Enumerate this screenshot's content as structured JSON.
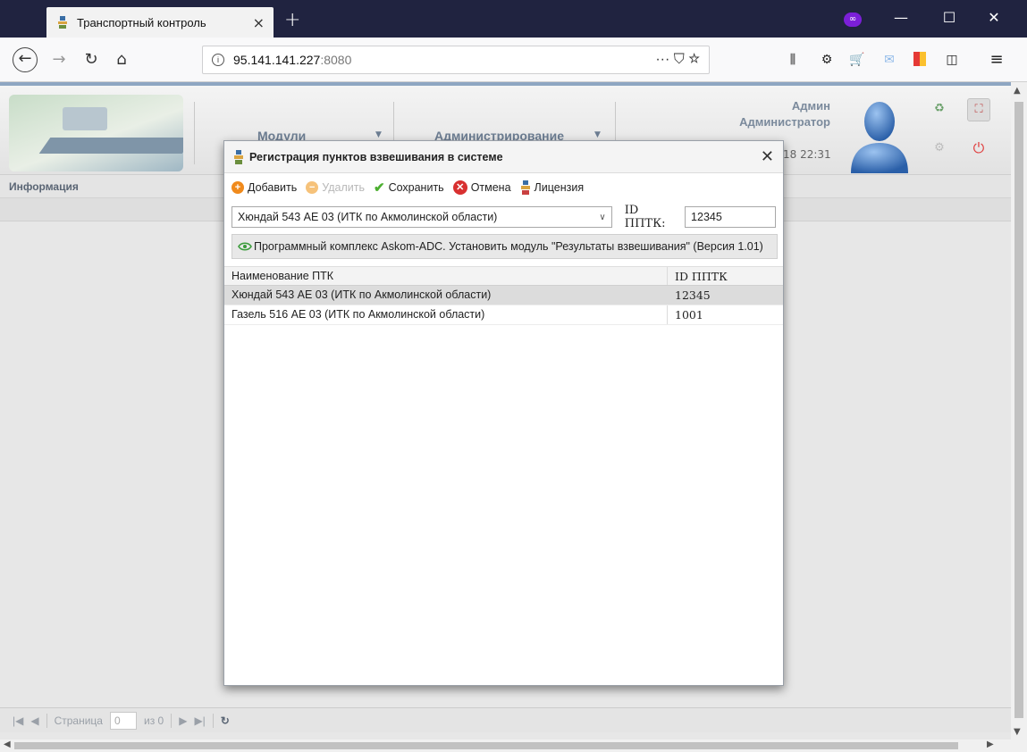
{
  "browser": {
    "tab_title": "Транспортный контроль",
    "tab_close": "×",
    "new_tab": "+",
    "url_host": "95.141.141.227",
    "url_port": ":8080",
    "url_actions": "··· ⛉ ☆"
  },
  "header": {
    "menu_modules": "Модули",
    "menu_admin": "Администрирование",
    "user_name": "Админ",
    "user_role": "Администратор",
    "session_time": "18 22:31"
  },
  "info_bar": {
    "label": "Информация"
  },
  "pager": {
    "page_label": "Страница",
    "page_value": "0",
    "of_label": "из 0"
  },
  "dialog": {
    "title": "Регистрация пунктов взвешивания в системе",
    "toolbar": {
      "add": "Добавить",
      "delete": "Удалить",
      "save": "Сохранить",
      "cancel": "Отмена",
      "license": "Лицензия"
    },
    "select_value": "Хюндай 543 АЕ 03 (ИТК по Акмолинской области)",
    "id_label": "ID ППТК:",
    "id_value": "12345",
    "module_text": "Программный комплекс Askom-ADC. Установить модуль \"Результаты взвешивания\" (Версия 1.01)",
    "columns": [
      "Наименование ПТК",
      "ID ППТК"
    ],
    "rows": [
      {
        "name": "Хюндай 543 АЕ 03 (ИТК по Акмолинской области)",
        "id": "12345"
      },
      {
        "name": "Газель 516 АЕ 03 (ИТК по Акмолинской области)",
        "id": "1001"
      }
    ]
  },
  "colors": {
    "titlebar": "#202340",
    "accent_purple": "#7b1fd8",
    "add_orange": "#f08a1c",
    "save_green": "#4caf30",
    "cancel_red": "#d83030"
  }
}
